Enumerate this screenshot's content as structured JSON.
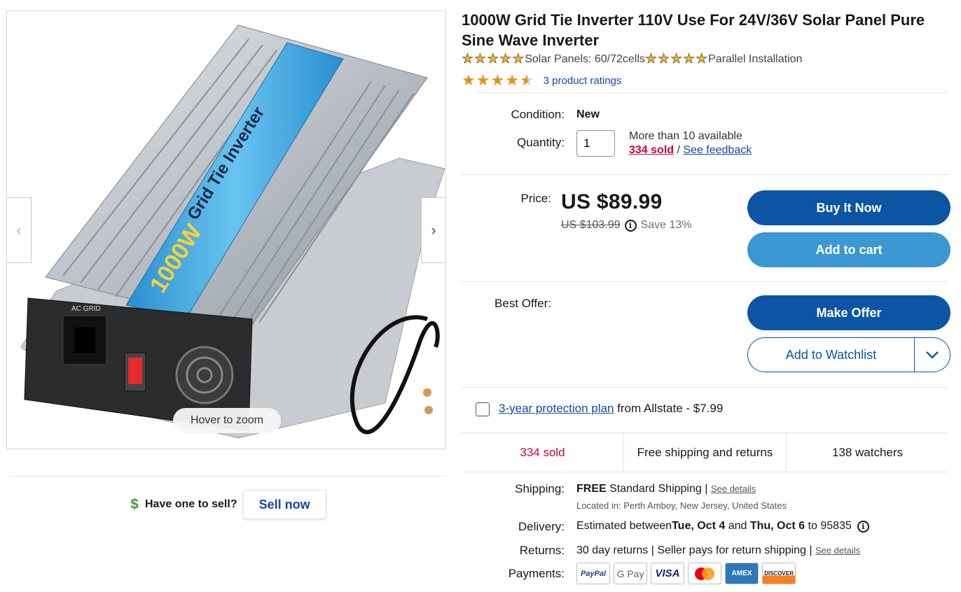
{
  "product": {
    "title": "1000W Grid Tie Inverter 110V Use For 24V/36V Solar Panel Pure Sine Wave Inverter",
    "features": [
      "Solar Panels: 60/72cells",
      "Parallel Installation"
    ],
    "rating_stars": 4.5,
    "ratings_link": "3 product ratings"
  },
  "gallery": {
    "zoom_hint": "Hover to zoom",
    "prev_icon": "chevron-left-icon",
    "next_icon": "chevron-right-icon"
  },
  "sell": {
    "question": "Have one to sell?",
    "button": "Sell now"
  },
  "condition": {
    "label": "Condition:",
    "value": "New"
  },
  "quantity": {
    "label": "Quantity:",
    "value": "1",
    "available": "More than 10 available",
    "sold": "334 sold",
    "separator": " / ",
    "feedback": "See feedback"
  },
  "price": {
    "label": "Price:",
    "current": "US $89.99",
    "was": "US $103.99",
    "save": "Save 13%"
  },
  "actions": {
    "buy_now": "Buy It Now",
    "add_to_cart": "Add to cart",
    "best_offer_label": "Best Offer:",
    "make_offer": "Make Offer",
    "watchlist": "Add to Watchlist"
  },
  "protection": {
    "link": "3-year protection plan",
    "text": " from Allstate - $7.99"
  },
  "stats": [
    "334 sold",
    "Free shipping and returns",
    "138 watchers"
  ],
  "shipping": {
    "label": "Shipping:",
    "free": "FREE",
    "method": " Standard Shipping | ",
    "details": "See details",
    "location": "Located in: Perth Amboy, New Jersey, United States"
  },
  "delivery": {
    "label": "Delivery:",
    "prefix": "Estimated between ",
    "start": "Tue, Oct 4",
    "and": " and ",
    "end": "Thu, Oct 6",
    "to": " to 95835"
  },
  "returns": {
    "label": "Returns:",
    "text": "30 day returns | Seller pays for return shipping | ",
    "details": "See details"
  },
  "payments": {
    "label": "Payments:",
    "methods": [
      "PayPal",
      "G Pay",
      "VISA",
      "Mastercard",
      "AMEX",
      "DISCOVER"
    ]
  },
  "colors": {
    "primary_blue": "#0b55a4",
    "cart_blue": "#3d97d1",
    "link_blue": "#1547a6",
    "sold_red": "#c7063c",
    "star_orange": "#f18b13"
  }
}
